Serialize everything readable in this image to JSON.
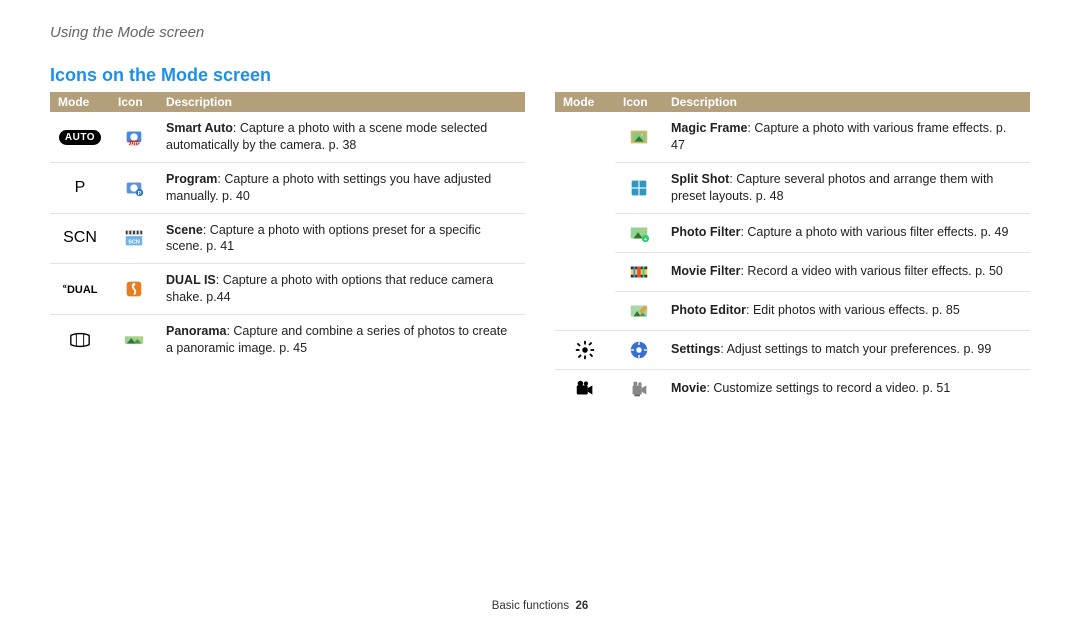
{
  "breadcrumb": "Using the Mode screen",
  "section_title": "Icons on the Mode screen",
  "columns": {
    "mode": "Mode",
    "icon": "Icon",
    "description": "Description"
  },
  "tables": {
    "left": [
      {
        "mode_display": "AUTO",
        "mode_kind": "pill",
        "icon": "auto-icon",
        "title": "Smart Auto",
        "rest": ": Capture a photo with a scene mode selected automatically by the camera. p. 38"
      },
      {
        "mode_display": "P",
        "mode_kind": "big",
        "icon": "program-icon",
        "title": "Program",
        "rest": ": Capture a photo with settings you have adjusted manually. p. 40"
      },
      {
        "mode_display": "SCN",
        "mode_kind": "big",
        "icon": "scene-icon",
        "title": "Scene",
        "rest": ": Capture a photo with options preset for a specific scene. p. 41"
      },
      {
        "mode_display": "DUAL",
        "mode_kind": "small",
        "icon": "dualis-icon",
        "title": "DUAL IS",
        "rest": ": Capture a photo with options that reduce camera shake. p.44"
      },
      {
        "mode_display": "",
        "mode_kind": "svg",
        "mode_svg": "panorama-mode-icon",
        "icon": "panorama-icon",
        "title": "Panorama",
        "rest": ": Capture and combine a series of photos to create a panoramic image. p. 45"
      }
    ],
    "right": [
      {
        "mode_display": "",
        "mode_kind": "none",
        "icon": "magicframe-icon",
        "title": "Magic Frame",
        "rest": ": Capture a photo with various frame effects. p. 47",
        "rowspan_mode": 5,
        "mode_svg": "magic-mode-icon"
      },
      {
        "mode_display": "",
        "mode_kind": "row",
        "icon": "splitshot-icon",
        "title": "Split Shot",
        "rest": ": Capture several photos and arrange them with preset layouts. p. 48"
      },
      {
        "mode_display": "",
        "mode_kind": "row",
        "icon": "photofilter-icon",
        "title": "Photo Filter",
        "rest": ": Capture a photo with various filter effects. p. 49"
      },
      {
        "mode_display": "",
        "mode_kind": "row",
        "icon": "moviefilter-icon",
        "title": "Movie Filter",
        "rest": ": Record a video with various filter effects. p. 50"
      },
      {
        "mode_display": "",
        "mode_kind": "row",
        "icon": "photoeditor-icon",
        "title": "Photo Editor",
        "rest": ": Edit photos with various effects. p. 85"
      },
      {
        "mode_display": "",
        "mode_kind": "svg",
        "mode_svg": "settings-mode-icon",
        "icon": "settings-icon",
        "title": "Settings",
        "rest": ": Adjust settings to match your preferences. p. 99"
      },
      {
        "mode_display": "",
        "mode_kind": "svg",
        "mode_svg": "movie-mode-icon",
        "icon": "movie-icon",
        "title": "Movie",
        "rest": ": Customize settings to record a video. p. 51"
      }
    ]
  },
  "footer": {
    "section": "Basic functions",
    "page": "26"
  }
}
